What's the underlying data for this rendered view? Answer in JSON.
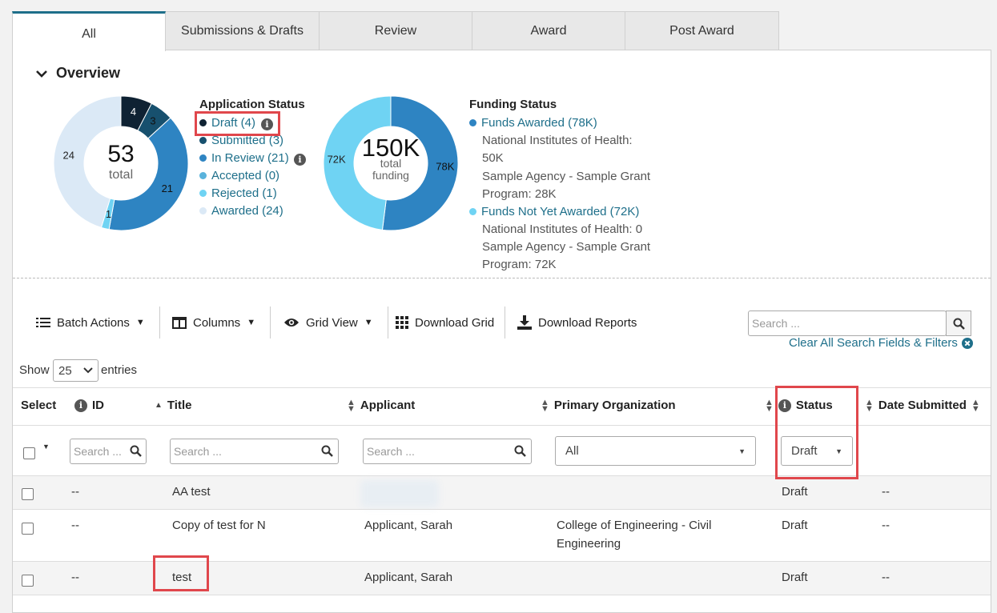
{
  "tabs": [
    {
      "label": "All"
    },
    {
      "label": "Submissions & Drafts"
    },
    {
      "label": "Review"
    },
    {
      "label": "Award"
    },
    {
      "label": "Post Award"
    }
  ],
  "overview": {
    "title": "Overview",
    "app_chart": {
      "total": "53",
      "total_label": "total",
      "segments": [
        {
          "label": "4",
          "value": 4,
          "color": "#0f2233"
        },
        {
          "label": "3",
          "value": 3,
          "color": "#17506e"
        },
        {
          "label": "21",
          "value": 21,
          "color": "#2e84c2"
        },
        {
          "label": "",
          "value": 0,
          "color": "#5ab3dc"
        },
        {
          "label": "1",
          "value": 1,
          "color": "#6fd3f3"
        },
        {
          "label": "24",
          "value": 24,
          "color": "#dbe9f6"
        }
      ]
    },
    "application_status": {
      "title": "Application Status",
      "items": [
        {
          "label": "Draft (4)",
          "color": "#0f2233"
        },
        {
          "label": "Submitted (3)",
          "color": "#17506e"
        },
        {
          "label": "In Review (21)",
          "color": "#2e84c2"
        },
        {
          "label": "Accepted (0)",
          "color": "#5ab3dc"
        },
        {
          "label": "Rejected (1)",
          "color": "#6fd3f3"
        },
        {
          "label": "Awarded (24)",
          "color": "#dbe9f6"
        }
      ]
    },
    "fund_chart": {
      "total": "150K",
      "total_label_1": "total",
      "total_label_2": "funding",
      "segments": [
        {
          "label": "78K",
          "value": 78,
          "color": "#2e84c2"
        },
        {
          "label": "72K",
          "value": 72,
          "color": "#6fd3f3"
        }
      ]
    },
    "funding_status": {
      "title": "Funding Status",
      "awarded": {
        "label": "Funds Awarded (78K)",
        "color": "#2e84c2",
        "lines": [
          "National Institutes of Health:",
          "50K",
          "Sample Agency - Sample Grant",
          "Program: 28K"
        ]
      },
      "not_awarded": {
        "label": "Funds Not Yet Awarded (72K)",
        "color": "#6fd3f3",
        "lines": [
          "National Institutes of Health: 0",
          "Sample Agency - Sample Grant",
          "Program: 72K"
        ]
      }
    }
  },
  "toolbar": {
    "batch_actions": "Batch Actions",
    "columns": "Columns",
    "grid_view": "Grid View",
    "download_grid": "Download Grid",
    "download_reports": "Download Reports",
    "search_placeholder": "Search ...",
    "clear_filters": "Clear All Search Fields & Filters"
  },
  "entries": {
    "show": "Show",
    "value": "25",
    "suffix": "entries"
  },
  "table": {
    "headers": {
      "select": "Select",
      "id": "ID",
      "title": "Title",
      "applicant": "Applicant",
      "organization": "Primary Organization",
      "status": "Status",
      "date": "Date Submitted"
    },
    "filters": {
      "search_placeholder": "Search ...",
      "org_value": "All",
      "status_value": "Draft"
    },
    "rows": [
      {
        "id": "--",
        "title": "AA test",
        "applicant": "",
        "org_line1": "",
        "org_line2": "",
        "status": "Draft",
        "date": "--"
      },
      {
        "id": "--",
        "title": "Copy of test for N",
        "applicant": "Applicant, Sarah",
        "org_line1": "College of Engineering - Civil",
        "org_line2": "Engineering",
        "status": "Draft",
        "date": "--"
      },
      {
        "id": "--",
        "title": "test",
        "applicant": "Applicant, Sarah",
        "org_line1": "",
        "org_line2": "",
        "status": "Draft",
        "date": "--"
      }
    ]
  }
}
